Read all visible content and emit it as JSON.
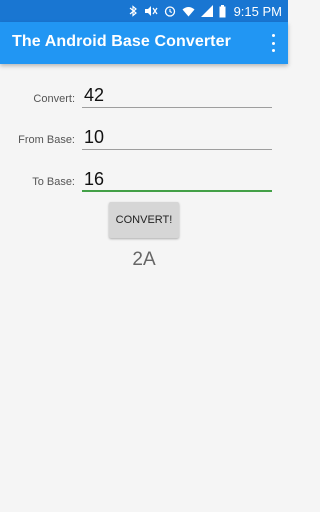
{
  "status_bar": {
    "time": "9:15 PM",
    "icons": [
      "bluetooth-icon",
      "mute-icon",
      "alarm-icon",
      "wifi-icon",
      "signal-icon",
      "battery-icon"
    ]
  },
  "app_bar": {
    "title": "The Android Base Converter",
    "menu_icon": "overflow-menu-icon"
  },
  "form": {
    "convert": {
      "label": "Convert:",
      "value": "42"
    },
    "from_base": {
      "label": "From Base:",
      "value": "10"
    },
    "to_base": {
      "label": "To Base:",
      "value": "16"
    }
  },
  "convert_button": "CONVERT!",
  "result": "2A",
  "colors": {
    "status_bar": "#1976d2",
    "app_bar": "#2196f3",
    "focus_underline": "#43a047"
  }
}
